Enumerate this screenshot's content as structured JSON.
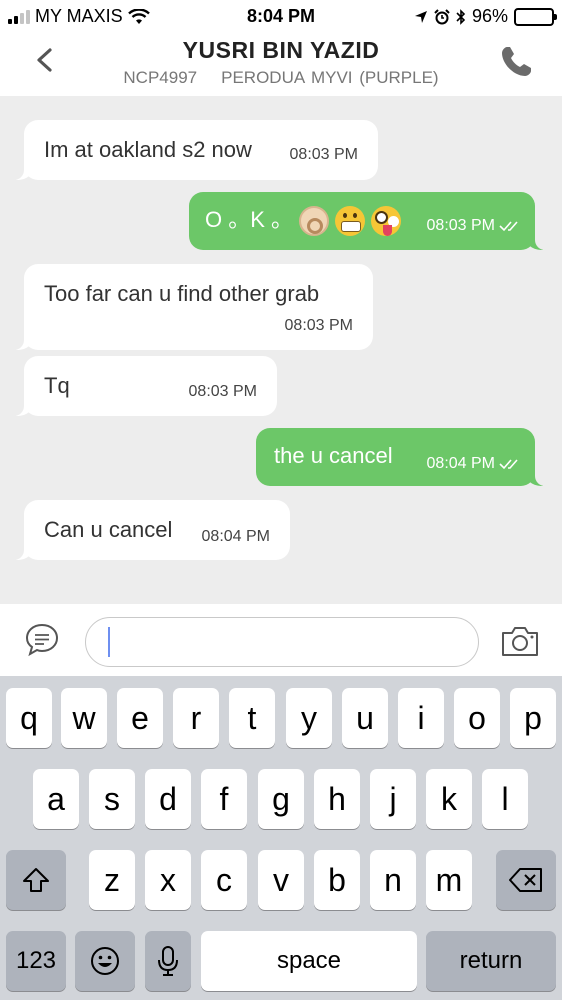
{
  "status_bar": {
    "carrier": "MY MAXIS",
    "time": "8:04 PM",
    "battery": "96%",
    "battery_level": 0.96,
    "icons": [
      "signal-icon",
      "wifi-icon",
      "location-arrow-icon",
      "alarm-icon",
      "bluetooth-icon",
      "battery-icon"
    ]
  },
  "header": {
    "driver_name": "YUSRI BIN YAZID",
    "plate": "NCP4997",
    "vehicle": "PERODUA MYVI (PURPLE)",
    "icons": [
      "back-chevron-icon",
      "phone-icon"
    ]
  },
  "messages": [
    {
      "direction": "in",
      "text": "Im at oakland s2 now",
      "time": "08:03 PM"
    },
    {
      "direction": "out",
      "text": "O 。K 。",
      "emojis": [
        "ok-hand-emoji",
        "grimacing-face-emoji",
        "zany-face-emoji"
      ],
      "time": "08:03 PM",
      "read": true
    },
    {
      "direction": "in",
      "text": "Too far can u find other grab",
      "time": "08:03 PM"
    },
    {
      "direction": "in",
      "text": "Tq",
      "time": "08:03 PM"
    },
    {
      "direction": "out",
      "text": "the u cancel",
      "time": "08:04 PM",
      "read": true
    },
    {
      "direction": "in",
      "text": "Can u cancel",
      "time": "08:04 PM"
    }
  ],
  "input_bar": {
    "value": "",
    "icons": [
      "chat-bubble-icon",
      "camera-icon"
    ]
  },
  "keyboard": {
    "row1": [
      "q",
      "w",
      "e",
      "r",
      "t",
      "y",
      "u",
      "i",
      "o",
      "p"
    ],
    "row2": [
      "a",
      "s",
      "d",
      "f",
      "g",
      "h",
      "j",
      "k",
      "l"
    ],
    "row3": [
      "z",
      "x",
      "c",
      "v",
      "b",
      "n",
      "m"
    ],
    "numbers_label": "123",
    "space_label": "space",
    "return_label": "return",
    "icons": [
      "shift-icon",
      "backspace-icon",
      "emoji-icon",
      "microphone-icon"
    ]
  },
  "colors": {
    "outgoing_bubble": "#6cc768",
    "incoming_bubble": "#ffffff",
    "chat_background": "#ededed",
    "keyboard_background": "#d1d4d9"
  }
}
